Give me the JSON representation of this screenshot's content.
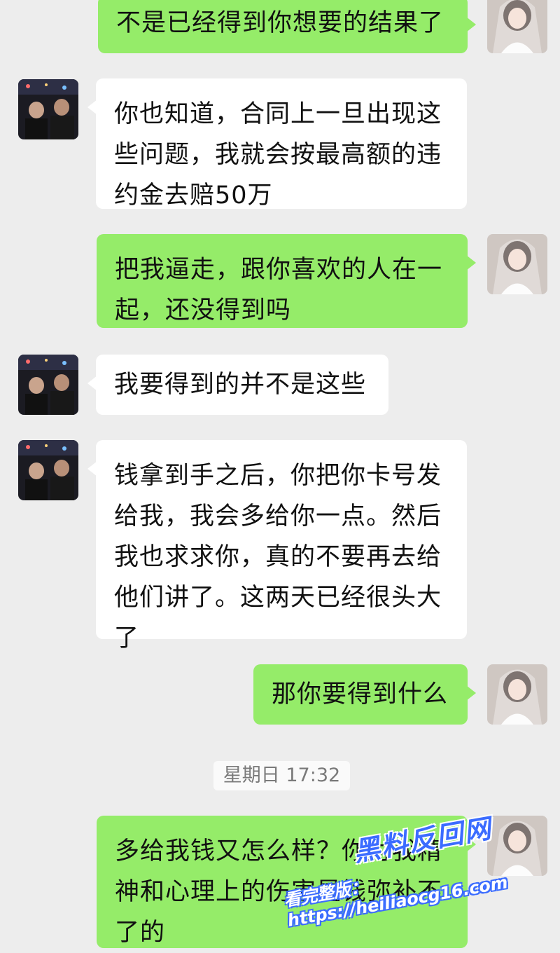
{
  "messages": [
    {
      "side": "me",
      "text": "不是已经得到你想要的结果了"
    },
    {
      "side": "other",
      "text": "你也知道，合同上一旦出现这\n些问题，我就会按最高额的违\n约金去赔50万"
    },
    {
      "side": "me",
      "text": "把我逼走，跟你喜欢的人在一\n起，还没得到吗"
    },
    {
      "side": "other",
      "text": "我要得到的并不是这些"
    },
    {
      "side": "other",
      "text": "钱拿到手之后，你把你卡号发\n给我，我会多给你一点。然后\n我也求求你，真的不要再去给\n他们讲了。这两天已经很头大\n了"
    },
    {
      "side": "me",
      "text": "那你要得到什么"
    },
    {
      "side": "me",
      "text": "多给我钱又怎么样？你对我精\n神和心理上的伤害是钱弥补不\n了的"
    }
  ],
  "timestamp": "星期日 17:32",
  "watermark": {
    "logo": "黑料反回网",
    "url": "看完整版：https://heiliaocg16.com"
  },
  "colors": {
    "background": "#ededed",
    "my_bubble": "#95ec69",
    "other_bubble": "#ffffff"
  },
  "icons": {
    "me_avatar": "bride-avatar-icon",
    "other_avatar": "group-photo-avatar-icon"
  }
}
